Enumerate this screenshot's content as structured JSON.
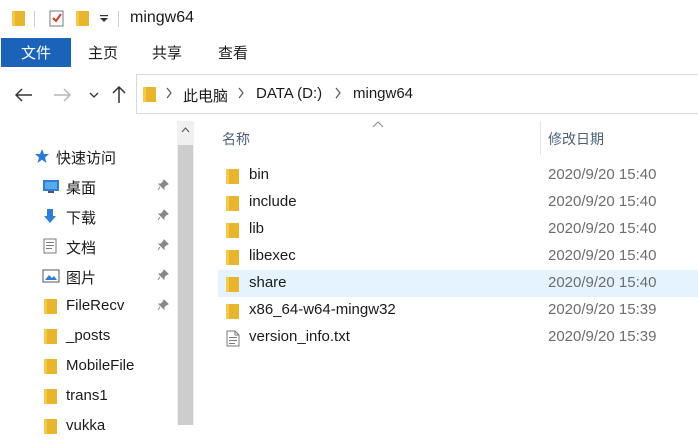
{
  "window": {
    "title": "mingw64"
  },
  "ribbon": {
    "tabs": [
      {
        "label": "文件",
        "active": true
      },
      {
        "label": "主页"
      },
      {
        "label": "共享"
      },
      {
        "label": "查看"
      }
    ]
  },
  "address": {
    "crumbs": [
      "此电脑",
      "DATA (D:)",
      "mingw64"
    ]
  },
  "nav": {
    "quick_access": "快速访问",
    "items": [
      {
        "label": "桌面",
        "icon": "desktop-icon",
        "pinned": true
      },
      {
        "label": "下载",
        "icon": "download-icon",
        "pinned": true
      },
      {
        "label": "文档",
        "icon": "document-icon",
        "pinned": true
      },
      {
        "label": "图片",
        "icon": "picture-icon",
        "pinned": true
      },
      {
        "label": "FileRecv",
        "icon": "folder-icon",
        "pinned": true
      },
      {
        "label": "_posts",
        "icon": "folder-icon"
      },
      {
        "label": "MobileFile",
        "icon": "folder-icon"
      },
      {
        "label": "trans1",
        "icon": "folder-icon"
      },
      {
        "label": "vukka",
        "icon": "folder-icon"
      }
    ]
  },
  "list": {
    "columns": {
      "name": "名称",
      "modified": "修改日期"
    },
    "files": [
      {
        "name": "bin",
        "modified": "2020/9/20 15:40",
        "type": "folder"
      },
      {
        "name": "include",
        "modified": "2020/9/20 15:40",
        "type": "folder"
      },
      {
        "name": "lib",
        "modified": "2020/9/20 15:40",
        "type": "folder"
      },
      {
        "name": "libexec",
        "modified": "2020/9/20 15:40",
        "type": "folder"
      },
      {
        "name": "share",
        "modified": "2020/9/20 15:40",
        "type": "folder",
        "selected": true
      },
      {
        "name": "x86_64-w64-mingw32",
        "modified": "2020/9/20 15:39",
        "type": "folder"
      },
      {
        "name": "version_info.txt",
        "modified": "2020/9/20 15:39",
        "type": "text-file"
      }
    ]
  },
  "colors": {
    "accent": "#1a63b8",
    "folder": "#f7c948",
    "selected_row": "#e5f3ff"
  }
}
